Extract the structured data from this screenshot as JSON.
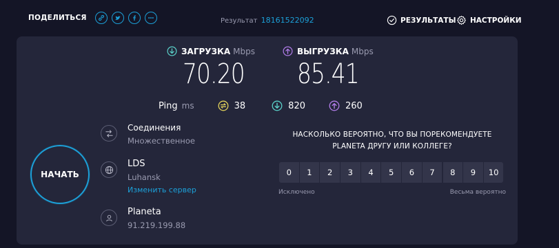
{
  "topbar": {
    "share_label": "ПОДЕЛИТЬСЯ",
    "share_icons": [
      "link-icon",
      "twitter-icon",
      "facebook-icon",
      "more-icon"
    ],
    "result_label": "Результат",
    "result_id": "18161522092",
    "results_label": "РЕЗУЛЬТАТЫ",
    "settings_label": "НАСТРОЙКИ"
  },
  "speed": {
    "download": {
      "label": "ЗАГРУЗКА",
      "unit": "Mbps",
      "value": "70.20",
      "icon": "download-arrow-icon"
    },
    "upload": {
      "label": "ВЫГРУЗКА",
      "unit": "Mbps",
      "value": "85.41",
      "icon": "upload-arrow-icon"
    }
  },
  "ping": {
    "label": "Ping",
    "unit": "ms",
    "idle": "38",
    "download": "820",
    "upload": "260"
  },
  "start_label": "НАЧАТЬ",
  "connections": {
    "title": "Соединения",
    "value": "Множественное"
  },
  "server": {
    "name": "LDS",
    "location": "Luhansk",
    "change_label": "Изменить сервер"
  },
  "provider": {
    "name": "Planeta",
    "ip": "91.219.199.88"
  },
  "survey": {
    "question": "НАСКОЛЬКО ВЕРОЯТНО, ЧТО ВЫ ПОРЕКОМЕНДУЕТЕ PLANETA ДРУГУ ИЛИ КОЛЛЕГЕ?",
    "scale": [
      "0",
      "1",
      "2",
      "3",
      "4",
      "5",
      "6",
      "7",
      "8",
      "9",
      "10"
    ],
    "low_label": "Исключено",
    "high_label": "Весьма вероятно"
  },
  "colors": {
    "background": "#141526",
    "panel": "#24263a",
    "accent": "#1ca0d8",
    "download": "#5ad0c8",
    "upload": "#b07ce8",
    "idle": "#e3d35a"
  }
}
